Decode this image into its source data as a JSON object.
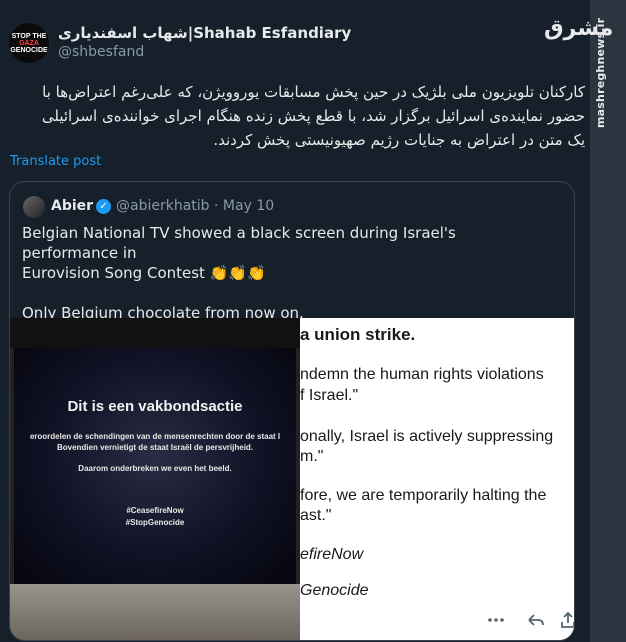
{
  "watermark": {
    "logo_text": "مشرق",
    "site": "mashreghnews.ir"
  },
  "author": {
    "avatar_lines": [
      "STOP THE",
      "GAZA",
      "GENOCIDE"
    ],
    "name": "شهاب اسفندیاری|Shahab Esfandiary",
    "handle": "@shbesfand"
  },
  "tweet": {
    "text": "کارکنان تلویزیون ملی بلژیک در حین پخش مسابقات یوروویژن، که علی‌رغم اعتراض‌ها با حضور نماینده‌ی اسرائیل برگزار شد، با قطع پخش زنده هنگام اجرای خواننده‌ی اسرائیلی یک متن در اعتراض به جنایات رژیم صهیونیستی پخش کردند.",
    "translate_label": "Translate post"
  },
  "quote": {
    "name": "Abier",
    "handle": "@abierkhatib",
    "date": "May 10",
    "separator": "·",
    "text_lines": [
      "Belgian National TV showed a black screen during Israel's performance in",
      "Eurovision Song Contest 👏👏👏"
    ],
    "text_line2": "Only Belgium chocolate from now on.",
    "tv_screen": {
      "headline": "Dit is een vakbondsactie",
      "line1": "eroordelen de schendingen van de mensenrechten door de staat I",
      "line2": "Bovendien vernietigt de staat Israël de persvrijheid.",
      "line3": "Daarom onderbreken we even het beeld.",
      "tag1": "#CeasefireNow",
      "tag2": "#StopGenocide"
    },
    "document_lines": [
      "a union strike.",
      "ndemn the human rights violations",
      "f Israel.\"",
      "onally, Israel is actively suppressing",
      "m.\"",
      "fore, we are temporarily halting the",
      "ast.\"",
      "efireNow",
      "Genocide"
    ],
    "icons": [
      "more-icon",
      "reply-icon",
      "share-icon"
    ]
  },
  "colors": {
    "background": "#15202b",
    "link": "#1d9bf0",
    "muted": "#8b98a5",
    "border": "#38444d"
  }
}
